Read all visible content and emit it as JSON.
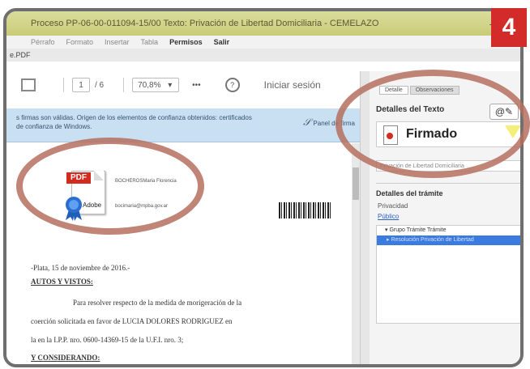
{
  "window": {
    "title": "Proceso PP-06-00-011094-15/00 Texto: Privación de Libertad Domiciliaria - CEMELAZO",
    "minimize_glyph": "–"
  },
  "step_badge": "4",
  "menu": {
    "items": [
      "Pérrafo",
      "Formato",
      "Insertar",
      "Tabla"
    ],
    "permisos": "Permisos",
    "salir": "Salir"
  },
  "file_tab": "e.PDF",
  "pdf_toolbar": {
    "page_current": "1",
    "page_total": "/ 6",
    "zoom": "70,8%",
    "zoom_caret": "▾",
    "more": "•••",
    "help": "?",
    "signin": "Iniciar sesión"
  },
  "notice": {
    "text": "s firmas son válidas. Origen de los elementos de confianza obtenidos: certificados de confianza de Windows.",
    "panel_button": "Panel de firma"
  },
  "document": {
    "pdf_badge": "PDF",
    "adobe_label": "Adobe",
    "signer_name": "BOCHEROSMaria Florencia",
    "signer_email": "bocimaria@mpba.gov.ar",
    "lines": [
      "-Plata,  15  de noviembre de 2016.-",
      "AUTOS Y VISTOS:",
      "Para resolver respecto de la medida de morigeración   de la",
      "coerción solicitada en favor de LUCIA DOLORES RODRIGUEZ en",
      "la en la I.P.P. nro. 0600-14369-15 de la U.F.I.  nro. 3;",
      "Y CONSIDERANDO:"
    ]
  },
  "right_panel": {
    "tabs": [
      "Detalle",
      "Observaciones"
    ],
    "details_title": "Detalles del Texto",
    "at_button": "@✎",
    "firmado_label": "Firmado",
    "text_field": "Privación de Libertad Domiciliaria",
    "tramite_title": "Detalles del trámite",
    "privacidad_label": "Privacidad",
    "publico_link": "Público",
    "tree_header": "▾ Grupo Trámite   Trámite",
    "tree_row": "▸  Resolución   Privación de Libertad"
  },
  "colors": {
    "title_bar": "#d0d388",
    "notice": "#c9dff2",
    "circle": "#b5705f",
    "badge": "#d32a2a",
    "tree_selected": "#3b7be0"
  }
}
